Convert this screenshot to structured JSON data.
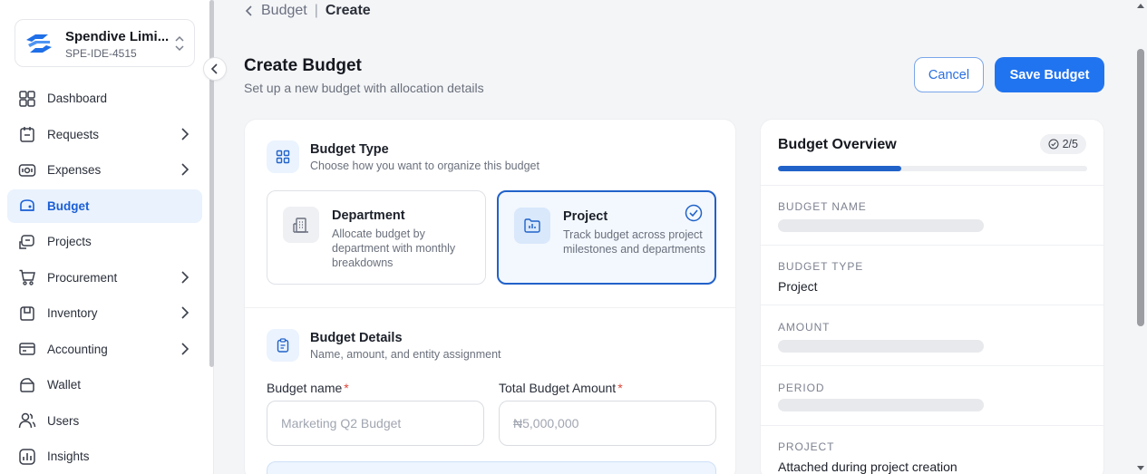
{
  "org": {
    "name": "Spendive Limi...",
    "id": "SPE-IDE-4515"
  },
  "nav": [
    {
      "label": "Dashboard",
      "icon": "dashboard-icon",
      "chevron": false,
      "active": false
    },
    {
      "label": "Requests",
      "icon": "requests-icon",
      "chevron": true,
      "active": false
    },
    {
      "label": "Expenses",
      "icon": "expenses-icon",
      "chevron": true,
      "active": false
    },
    {
      "label": "Budget",
      "icon": "budget-icon",
      "chevron": false,
      "active": true
    },
    {
      "label": "Projects",
      "icon": "projects-icon",
      "chevron": false,
      "active": false
    },
    {
      "label": "Procurement",
      "icon": "procurement-icon",
      "chevron": true,
      "active": false
    },
    {
      "label": "Inventory",
      "icon": "inventory-icon",
      "chevron": true,
      "active": false
    },
    {
      "label": "Accounting",
      "icon": "accounting-icon",
      "chevron": true,
      "active": false
    },
    {
      "label": "Wallet",
      "icon": "wallet-icon",
      "chevron": false,
      "active": false
    },
    {
      "label": "Users",
      "icon": "users-icon",
      "chevron": false,
      "active": false
    },
    {
      "label": "Insights",
      "icon": "insights-icon",
      "chevron": false,
      "active": false
    }
  ],
  "breadcrumb": {
    "parent": "Budget",
    "separator": "|",
    "current": "Create"
  },
  "header": {
    "title": "Create Budget",
    "subtitle": "Set up a new budget with allocation details",
    "cancel_label": "Cancel",
    "save_label": "Save Budget"
  },
  "budget_type": {
    "title": "Budget Type",
    "subtitle": "Choose how you want to organize this budget",
    "options": [
      {
        "title": "Department",
        "description": "Allocate budget by department with monthly breakdowns",
        "selected": false
      },
      {
        "title": "Project",
        "description": "Track budget across project milestones and departments",
        "selected": true
      }
    ]
  },
  "budget_details": {
    "title": "Budget Details",
    "subtitle": "Name, amount, and entity assignment",
    "name_label": "Budget name",
    "name_placeholder": "Marketing Q2 Budget",
    "name_value": "",
    "amount_label": "Total Budget Amount",
    "amount_placeholder": "₦5,000,000",
    "amount_value": "",
    "required_mark": "*"
  },
  "overview": {
    "title": "Budget Overview",
    "step_badge": "2/5",
    "progress": 0.4,
    "rows": [
      {
        "label": "BUDGET NAME",
        "value": ""
      },
      {
        "label": "BUDGET TYPE",
        "value": "Project"
      },
      {
        "label": "AMOUNT",
        "value": ""
      },
      {
        "label": "PERIOD",
        "value": ""
      },
      {
        "label": "PROJECT",
        "value": "Attached during project creation"
      }
    ]
  },
  "colors": {
    "primary": "#2174ef",
    "active_nav_bg": "#e9f2fd",
    "selected_border": "#2162c9",
    "required": "#e0463a"
  }
}
